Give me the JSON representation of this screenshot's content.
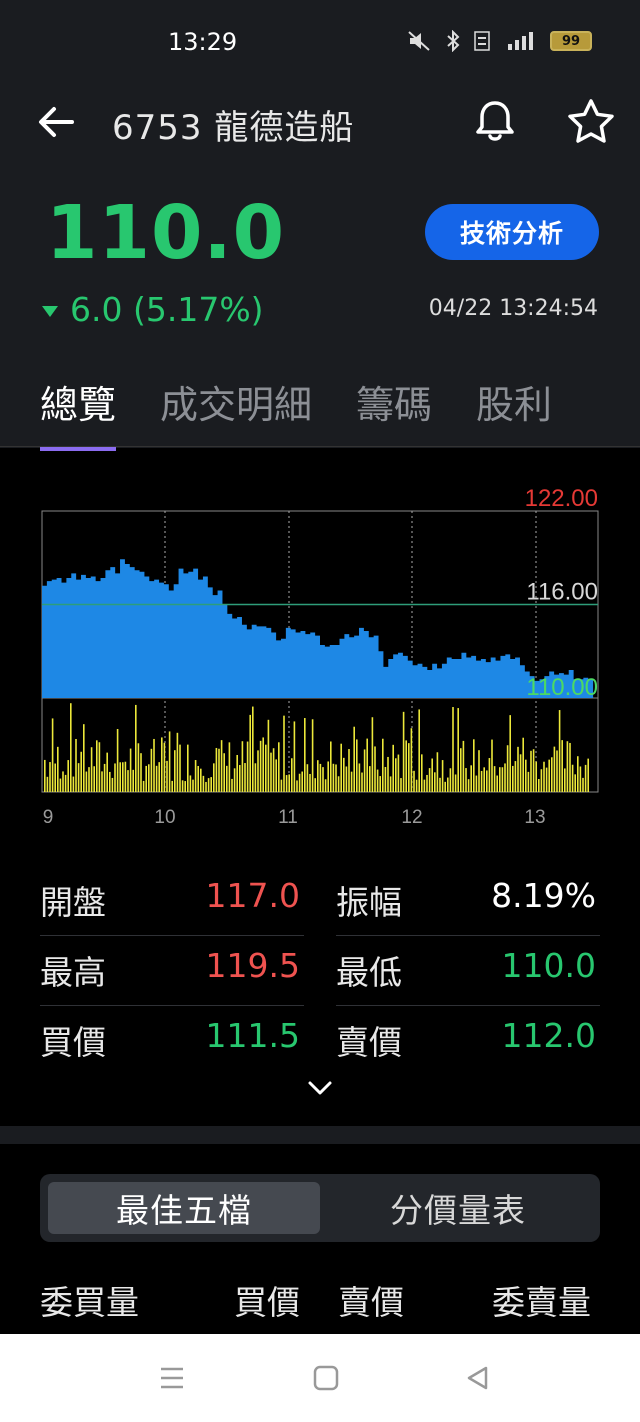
{
  "status_bar": {
    "time": "13:29",
    "icons": [
      "mute-icon",
      "bluetooth-icon",
      "volte-icon",
      "4g-signal-icon"
    ],
    "battery": "99"
  },
  "header": {
    "title": "6753 龍德造船"
  },
  "quote": {
    "price": "110.0",
    "change": "6.0 (5.17%)",
    "direction": "down",
    "timestamp": "04/22 13:24:54",
    "analysis_button": "技術分析"
  },
  "tabs": [
    "總覽",
    "成交明細",
    "籌碼",
    "股利"
  ],
  "chart_data": {
    "type": "area",
    "y_labels": {
      "high": "122.00",
      "mid": "116.00",
      "low": "110.00"
    },
    "ylim": [
      110,
      122
    ],
    "reference": 116,
    "x_ticks": [
      "9",
      "10",
      "11",
      "12",
      "13"
    ],
    "price": [
      117.2,
      117.5,
      117.6,
      117.7,
      117.4,
      117.7,
      118.0,
      117.6,
      117.9,
      117.7,
      117.8,
      117.5,
      117.7,
      118.2,
      118.4,
      118.0,
      118.9,
      118.6,
      118.4,
      118.2,
      118.1,
      117.8,
      117.5,
      117.6,
      117.4,
      117.3,
      116.9,
      117.3,
      118.3,
      118.0,
      118.1,
      118.3,
      117.6,
      117.8,
      117.1,
      116.6,
      116.9,
      116.0,
      115.4,
      115.1,
      115.2,
      114.7,
      114.4,
      114.7,
      114.6,
      114.6,
      114.5,
      114.2,
      113.7,
      113.8,
      114.5,
      114.4,
      114.2,
      114.3,
      114.1,
      114.2,
      114.0,
      113.4,
      113.3,
      113.4,
      113.4,
      113.8,
      114.1,
      113.9,
      114.0,
      114.5,
      114.3,
      113.9,
      114.0,
      113.0,
      112.0,
      112.5,
      112.8,
      112.9,
      112.7,
      112.4,
      112.1,
      112.2,
      112.0,
      111.8,
      112.2,
      111.9,
      112.2,
      112.6,
      112.5,
      112.5,
      112.9,
      112.6,
      112.7,
      112.4,
      112.5,
      112.3,
      112.6,
      112.4,
      112.7,
      112.8,
      112.5,
      112.6,
      112.1,
      111.7,
      111.4,
      111.1,
      111.2,
      111.4,
      111.7,
      111.5,
      111.6,
      111.5,
      111.8,
      111.2,
      111.2,
      111.3,
      111.2
    ],
    "volume_color": "#ece83a",
    "area_color": "#1e88e5",
    "reference_color": "#2e9d7a"
  },
  "stats": [
    {
      "l_label": "開盤",
      "l_value": "117.0",
      "l_color": "red",
      "r_label": "振幅",
      "r_value": "8.19%",
      "r_color": "white"
    },
    {
      "l_label": "最高",
      "l_value": "119.5",
      "l_color": "red",
      "r_label": "最低",
      "r_value": "110.0",
      "r_color": "green"
    },
    {
      "l_label": "買價",
      "l_value": "111.5",
      "l_color": "green",
      "r_label": "賣價",
      "r_value": "112.0",
      "r_color": "green"
    }
  ],
  "segment": {
    "active": "最佳五檔",
    "inactive": "分價量表"
  },
  "columns": {
    "bid_qty": "委買量",
    "bid": "買價",
    "ask": "賣價",
    "ask_qty": "委賣量"
  },
  "colors": {
    "up": "#ef5350",
    "down": "#28c76f",
    "accent": "#1565e8",
    "tab_indicator": "#8b6cf0"
  }
}
